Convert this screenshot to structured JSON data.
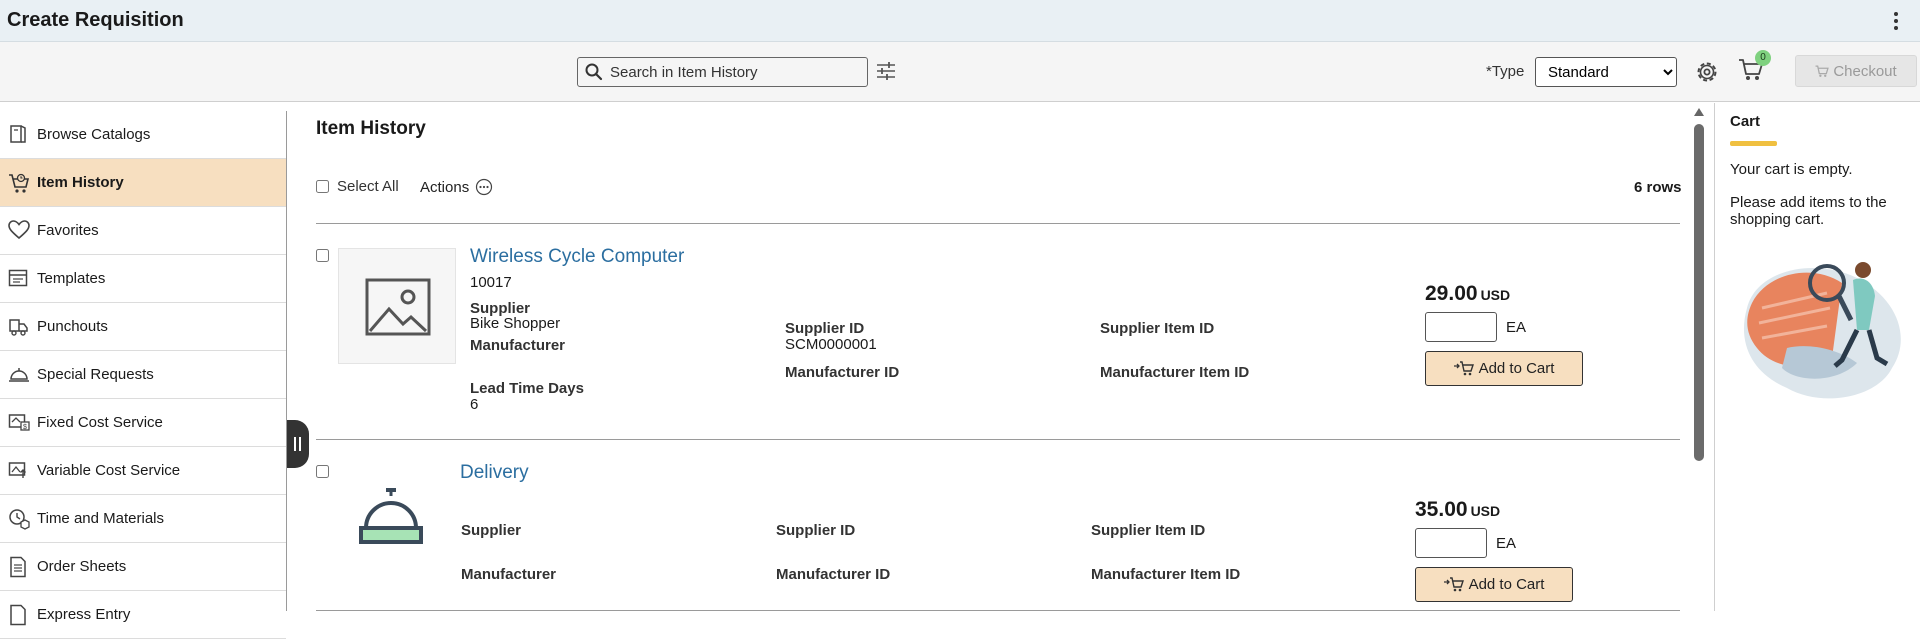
{
  "app": {
    "title": "Create Requisition"
  },
  "toolbar": {
    "search_placeholder": "Search in Item History",
    "type_label": "*Type",
    "type_value": "Standard",
    "type_options": [
      "Standard"
    ],
    "cart_count": "0",
    "checkout_label": "Checkout"
  },
  "sidebar": {
    "items": [
      {
        "label": "Browse Catalogs",
        "icon": "book-open-icon"
      },
      {
        "label": "Item History",
        "icon": "cart-history-icon"
      },
      {
        "label": "Favorites",
        "icon": "heart-icon"
      },
      {
        "label": "Templates",
        "icon": "template-icon"
      },
      {
        "label": "Punchouts",
        "icon": "truck-icon"
      },
      {
        "label": "Special Requests",
        "icon": "service-bell-icon"
      },
      {
        "label": "Fixed Cost Service",
        "icon": "fixed-cost-icon"
      },
      {
        "label": "Variable Cost Service",
        "icon": "variable-cost-icon"
      },
      {
        "label": "Time and Materials",
        "icon": "time-materials-icon"
      },
      {
        "label": "Order Sheets",
        "icon": "document-icon"
      },
      {
        "label": "Express Entry",
        "icon": "express-entry-icon"
      }
    ]
  },
  "main": {
    "title": "Item History",
    "select_all": "Select All",
    "actions": "Actions",
    "rows": "6 rows",
    "labels": {
      "supplier": "Supplier",
      "manufacturer": "Manufacturer",
      "supplier_id": "Supplier ID",
      "supplier_item_id": "Supplier Item ID",
      "manufacturer_id": "Manufacturer ID",
      "manufacturer_item_id": "Manufacturer Item ID",
      "lead_time_days": "Lead Time Days",
      "add_to_cart": "Add to Cart"
    },
    "items": [
      {
        "name": "Wireless Cycle Computer",
        "code": "10017",
        "supplier": "Bike Shopper",
        "supplier_id": "SCM0000001",
        "lead_time_days": "6",
        "price": "29.00",
        "currency": "USD",
        "uom": "EA",
        "image": "image-placeholder-icon"
      },
      {
        "name": "Delivery",
        "price": "35.00",
        "currency": "USD",
        "uom": "EA",
        "image": "service-bell-icon"
      }
    ]
  },
  "cart": {
    "title": "Cart",
    "empty": "Your cart is empty.",
    "add_items": "Please add items to the shopping cart."
  },
  "colors": {
    "active_nav": "#f7dfc0",
    "link": "#2b6ea0",
    "accent_underline": "#f0c040",
    "header_bg": "#e9f0f4"
  }
}
